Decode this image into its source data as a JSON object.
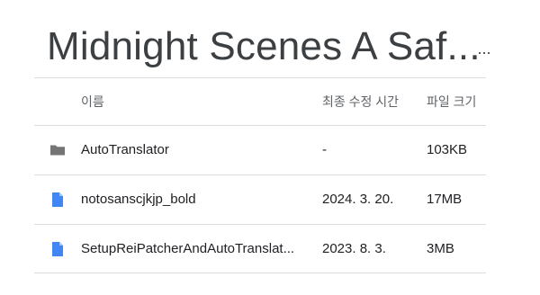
{
  "folder": {
    "title": "Midnight Scenes A Saf...",
    "more_label": "..."
  },
  "columns": {
    "name": "이름",
    "modified": "최종 수정 시간",
    "size": "파일 크기"
  },
  "files": [
    {
      "name": "AutoTranslator",
      "modified": "-",
      "size": "103KB",
      "icon": "folder-icon"
    },
    {
      "name": "notosanscjkjp_bold",
      "modified": "2024. 3. 20.",
      "size": "17MB",
      "icon": "file-icon"
    },
    {
      "name": "SetupReiPatcherAndAutoTranslat...",
      "modified": "2023. 8. 3.",
      "size": "3MB",
      "icon": "file-icon"
    }
  ],
  "colors": {
    "folder_icon": "#757575",
    "file_icon": "#4285f4",
    "divider": "#dadce0"
  }
}
